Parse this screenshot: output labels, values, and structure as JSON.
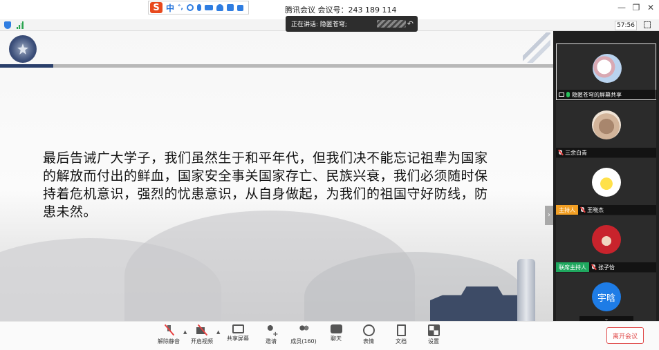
{
  "window": {
    "title": "腾讯会议 会议号：243 189 114",
    "controls": [
      "—",
      "❐",
      "✕"
    ]
  },
  "ime": {
    "logo": "S",
    "mode": "中",
    "punct": "°,"
  },
  "status": {
    "timer": "57:56"
  },
  "speaking": {
    "label": "正在讲话: 隐匿苍穹;"
  },
  "slide": {
    "text": "最后告诫广大学子，我们虽然生于和平年代，但我们决不能忘记祖辈为国家的解放而付出的鲜血，国家安全事关国家存亡、民族兴衰，我们必须随时保持着危机意识，强烈的忧患意识，从自身做起，为我们的祖国守好防线，防患未然。",
    "side_toggle": "›"
  },
  "participants": [
    {
      "name": "隐匿苍穹的屏幕共享",
      "role": "",
      "mic": "on",
      "sharing": true
    },
    {
      "name": "三余白青",
      "role": "",
      "mic": "muted",
      "sharing": false
    },
    {
      "name": "王晓杰",
      "role": "主持人",
      "mic": "muted",
      "sharing": false
    },
    {
      "name": "张子怡",
      "role": "联席主持人",
      "mic": "muted",
      "sharing": false
    },
    {
      "name": "",
      "avatar_text": "宇晗",
      "role": "",
      "mic": "muted",
      "sharing": false
    }
  ],
  "toolbar": {
    "unmute": "解除静音",
    "start_video": "开启视频",
    "share_screen": "共享屏幕",
    "invite": "邀请",
    "members": "成员(160)",
    "chat": "聊天",
    "emoji": "表情",
    "docs": "文档",
    "settings": "设置",
    "leave": "离开会议"
  },
  "colors": {
    "host_badge": "#f29f24",
    "cohost_badge": "#1fa85f",
    "leave_red": "#e04a4a",
    "mic_active": "#29c15c"
  }
}
